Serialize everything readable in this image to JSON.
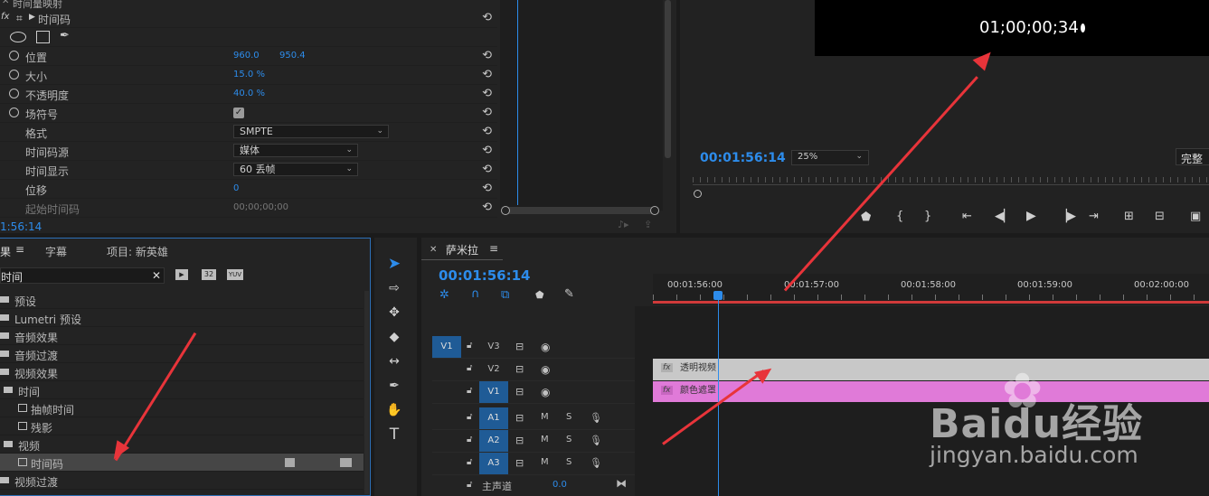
{
  "effect_controls": {
    "top_cut": "时间量映射",
    "group": "时间码",
    "rows": [
      {
        "label": "位置",
        "v1": "960.0",
        "v2": "950.4",
        "stopwatch": true
      },
      {
        "label": "大小",
        "v1": "15.0 %",
        "stopwatch": true
      },
      {
        "label": "不透明度",
        "v1": "40.0 %",
        "stopwatch": true
      },
      {
        "label": "场符号",
        "checkbox": true,
        "stopwatch": true
      },
      {
        "label": "格式",
        "select": "SMPTE"
      },
      {
        "label": "时间码源",
        "select": "媒体"
      },
      {
        "label": "时间显示",
        "select": "60 丢帧"
      },
      {
        "label": "位移",
        "v1": "0"
      },
      {
        "label": "起始时间码",
        "v1": "00;00;00;00",
        "dim": true
      }
    ],
    "timecode": "1:56:14"
  },
  "program_monitor": {
    "overlay_timecode": "01;00;00;34",
    "timecode": "00:01:56:14",
    "zoom": "25%",
    "quality": "完整"
  },
  "effects_panel": {
    "tabs": [
      "果",
      "字幕",
      "项目: 新英雄"
    ],
    "search_value": "时间",
    "items": [
      {
        "label": "预设",
        "indent": 0,
        "type": "folder"
      },
      {
        "label": "Lumetri 预设",
        "indent": 0,
        "type": "folder"
      },
      {
        "label": "音频效果",
        "indent": 0,
        "type": "folder"
      },
      {
        "label": "音频过渡",
        "indent": 0,
        "type": "folder"
      },
      {
        "label": "视频效果",
        "indent": 0,
        "type": "folder"
      },
      {
        "label": "时间",
        "indent": 1,
        "type": "folder"
      },
      {
        "label": "抽帧时间",
        "indent": 2,
        "type": "effect"
      },
      {
        "label": "残影",
        "indent": 2,
        "type": "effect"
      },
      {
        "label": "视频",
        "indent": 1,
        "type": "folder"
      },
      {
        "label": "时间码",
        "indent": 2,
        "type": "effect",
        "selected": true
      },
      {
        "label": "视频过渡",
        "indent": 0,
        "type": "folder"
      }
    ],
    "badges": [
      "32",
      "YUV"
    ]
  },
  "timeline": {
    "sequence_name": "萨米拉",
    "timecode": "00:01:56:14",
    "ruler": [
      "00:01:56:00",
      "00:01:57:00",
      "00:01:58:00",
      "00:01:59:00",
      "00:02:00:00"
    ],
    "tracks": [
      {
        "name": "V3",
        "src": "V1"
      },
      {
        "name": "V2"
      },
      {
        "name": "V1"
      },
      {
        "name": "A1",
        "m": "M",
        "s": "S"
      },
      {
        "name": "A2",
        "m": "M",
        "s": "S"
      },
      {
        "name": "A3",
        "m": "M",
        "s": "S"
      }
    ],
    "master_label": "主声道",
    "master_value": "0.0",
    "clips": [
      {
        "name": "透明视频",
        "color": "#c8c8c8"
      },
      {
        "name": "颜色遮罩",
        "color": "#e07ad8"
      }
    ]
  },
  "watermark": {
    "brand": "Baidu经验",
    "url": "jingyan.baidu.com"
  }
}
